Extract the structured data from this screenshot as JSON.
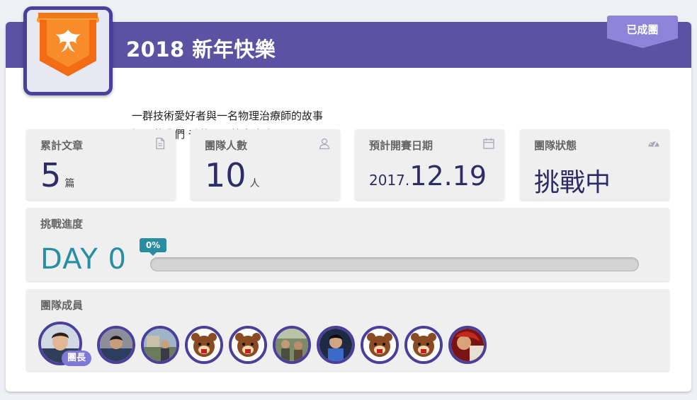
{
  "header": {
    "title": "2018 新年快樂",
    "status_ribbon": "已成團"
  },
  "description": {
    "line1": "一群技術愛好者與一名物理治療師的故事",
    "line2": "提醒著我們 千萬不要放棄治療"
  },
  "stats": {
    "articles": {
      "label": "累計文章",
      "value": "5",
      "unit": "篇",
      "icon": "document-icon"
    },
    "members_count": {
      "label": "團隊人數",
      "value": "10",
      "unit": "人",
      "icon": "user-icon"
    },
    "start_date": {
      "label": "預計開賽日期",
      "year": "2017.",
      "month_day": "12.19",
      "icon": "calendar-icon"
    },
    "status": {
      "label": "團隊狀態",
      "value": "挑戰中",
      "icon": "dashboard-icon"
    }
  },
  "progress": {
    "label": "挑戰進度",
    "day": "DAY 0",
    "percent_label": "0%",
    "percent": 0
  },
  "team": {
    "label": "團隊成員",
    "leader_tag": "團長",
    "members": [
      {
        "role": "leader",
        "avatar": "photo-person"
      },
      {
        "role": "member",
        "avatar": "photo-person"
      },
      {
        "role": "member",
        "avatar": "photo-outdoor"
      },
      {
        "role": "member",
        "avatar": "bear-default"
      },
      {
        "role": "member",
        "avatar": "bear-default"
      },
      {
        "role": "member",
        "avatar": "photo-group"
      },
      {
        "role": "member",
        "avatar": "photo-person-dark"
      },
      {
        "role": "member",
        "avatar": "bear-default"
      },
      {
        "role": "member",
        "avatar": "bear-default"
      },
      {
        "role": "member",
        "avatar": "photo-red"
      }
    ]
  },
  "colors": {
    "header": "#5b52a3",
    "ribbon": "#8b84d8",
    "accent_teal": "#2a8ea3",
    "number": "#2e2b67"
  }
}
